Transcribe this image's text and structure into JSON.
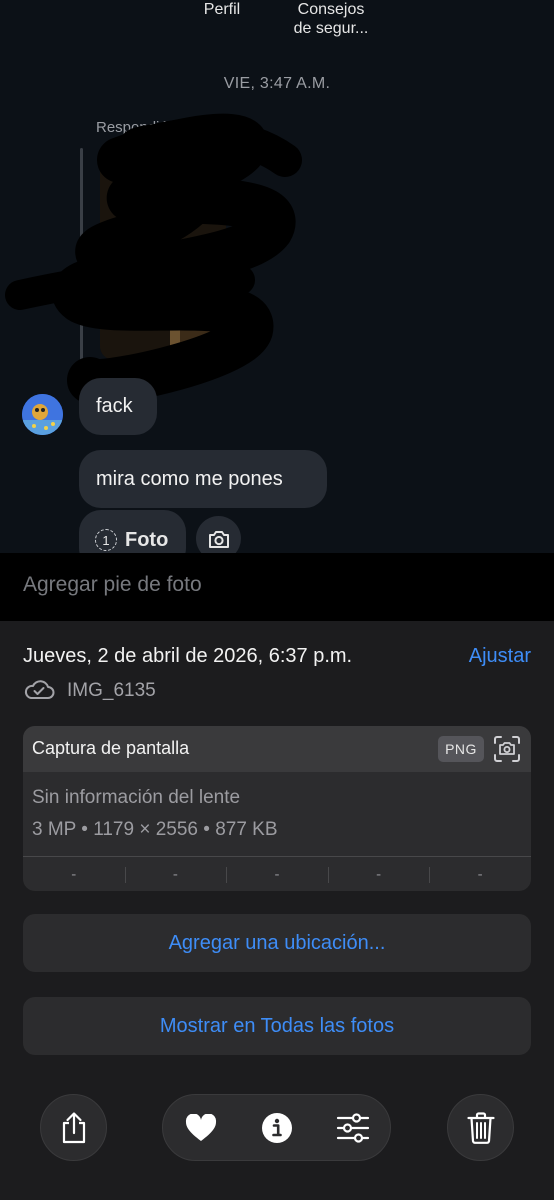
{
  "chat": {
    "top_links": [
      "Perfil",
      "Consejos\nde segur..."
    ],
    "timestamp": "VIE, 3:47 A.M.",
    "reply_label": "Respondió a tu historia",
    "messages": [
      "fack",
      "mira como me pones"
    ],
    "photo_count": "1",
    "photo_label": "Foto"
  },
  "caption": {
    "placeholder": "Agregar pie de foto"
  },
  "info": {
    "date": "Jueves, 2 de abril de 2026, 6:37 p.m.",
    "adjust_label": "Ajustar",
    "file_name": "IMG_6135",
    "meta": {
      "type": "Captura de pantalla",
      "format_badge": "PNG",
      "lens": "Sin información del lente",
      "specs": "3 MP • 1179 × 2556 • 877 KB",
      "exif": [
        "-",
        "-",
        "-",
        "-",
        "-"
      ]
    },
    "add_location_label": "Agregar una ubicación...",
    "show_all_label": "Mostrar en Todas las fotos"
  },
  "toolbar": {
    "icons": [
      "share-icon",
      "heart-icon",
      "info-icon",
      "sliders-icon",
      "trash-icon"
    ]
  },
  "colors": {
    "accent": "#3e8df7",
    "sheet_bg": "#1c1c1e",
    "card_bg": "#2c2c2e",
    "chat_bg": "#0c1117"
  }
}
